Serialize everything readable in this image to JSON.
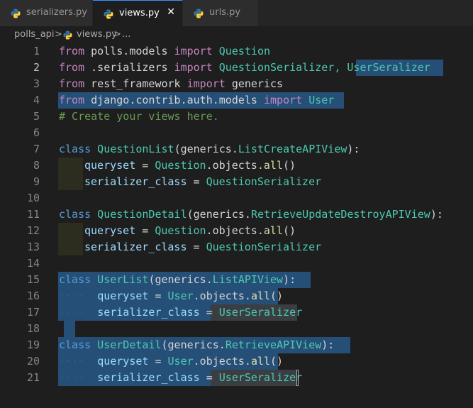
{
  "tabs": [
    {
      "label": "serializers.py",
      "active": false
    },
    {
      "label": "views.py",
      "active": true
    },
    {
      "label": "urls.py",
      "active": false
    }
  ],
  "close_glyph": "✕",
  "breadcrumb": {
    "folder": "polls_api",
    "sep": ">",
    "file": "views.py",
    "trail": "..."
  },
  "line_numbers": [
    "1",
    "2",
    "3",
    "4",
    "5",
    "6",
    "7",
    "8",
    "9",
    "10",
    "11",
    "12",
    "13",
    "14",
    "15",
    "16",
    "17",
    "18",
    "19",
    "20",
    "21"
  ],
  "code": {
    "l1": {
      "a": "from",
      "b": " polls.models ",
      "c": "import",
      "d": " Question"
    },
    "l2": {
      "a": "from",
      "b": " .serializers ",
      "c": "import",
      "d": " QuestionSerializer, ",
      "e": "UserSeralizer"
    },
    "l3": {
      "a": "from",
      "b": " rest_framework ",
      "c": "import",
      "d": " generics"
    },
    "l4": {
      "a": "from",
      "b": " django.contrib.auth.models ",
      "c": "import",
      "d": " User"
    },
    "l5": {
      "a": "# Create your views here."
    },
    "l7": {
      "a": "class",
      "b": " QuestionList",
      "c": "(generics.",
      "d": "ListCreateAPIView",
      "e": "):"
    },
    "l8": {
      "a": "queryset",
      "b": " = ",
      "c": "Question",
      "d": ".objects.",
      "e": "all",
      "f": "()"
    },
    "l9": {
      "a": "serializer_class",
      "b": " = ",
      "c": "QuestionSerializer"
    },
    "l11": {
      "a": "class",
      "b": " QuestionDetail",
      "c": "(generics.",
      "d": "RetrieveUpdateDestroyAPIView",
      "e": "):"
    },
    "l12": {
      "a": "queryset",
      "b": " = ",
      "c": "Question",
      "d": ".objects.",
      "e": "all",
      "f": "()"
    },
    "l13": {
      "a": "serializer_class",
      "b": " = ",
      "c": "QuestionSerializer"
    },
    "l15": {
      "a": "class",
      "b": " UserList",
      "c": "(generics.",
      "d": "ListAPIView",
      "e": "):"
    },
    "l16": {
      "ws": "····",
      "a": "queryset",
      "b": " = ",
      "c": "User",
      "d": ".objects.",
      "e": "all",
      "f": "()"
    },
    "l17": {
      "ws": "····",
      "a": "serializer_class",
      "b": " = ",
      "c": "UserSeralizer"
    },
    "l19": {
      "a": "class",
      "b": " UserDetail",
      "c": "(generics.",
      "d": "RetrieveAPIView",
      "e": "):"
    },
    "l20": {
      "ws": "····",
      "a": "queryset",
      "b": " = ",
      "c": "User",
      "d": ".objects.",
      "e": "all",
      "f": "()"
    },
    "l21": {
      "ws": "····",
      "a": "serializer_class",
      "b": " = ",
      "c": "UserSeralizer"
    }
  },
  "colors": {
    "keyword": "#c586c0",
    "class_kw": "#569cd6",
    "class_name": "#4ec9b0",
    "function": "#dcdcaa",
    "variable": "#9cdcfe",
    "comment": "#6a9955",
    "selection": "#264f78",
    "tab_accent": "#3794ff"
  },
  "icons": {
    "tab_file": "python-icon",
    "breadcrumb_file": "python-icon"
  }
}
